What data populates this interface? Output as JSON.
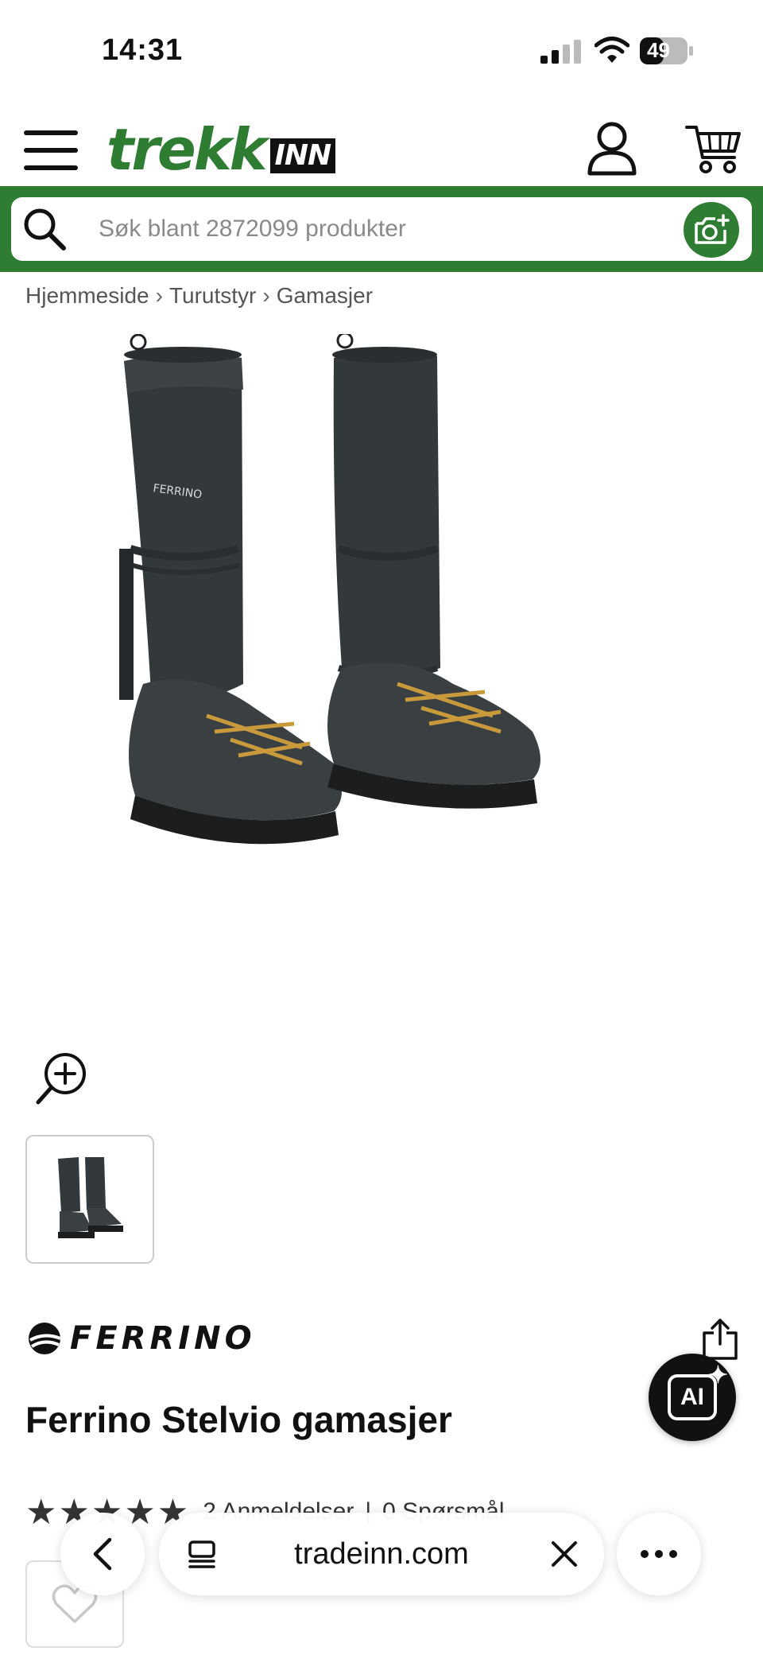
{
  "status_bar": {
    "time": "14:31",
    "battery": "49"
  },
  "header": {
    "logo_primary": "trekk",
    "logo_secondary": "INN"
  },
  "search": {
    "placeholder": "Søk blant 2872099 produkter"
  },
  "breadcrumb": [
    "Hjemmeside",
    "Turutstyr",
    "Gamasjer"
  ],
  "product": {
    "brand": "FERRINO",
    "name": "Ferrino Stelvio gamasjer",
    "image_brand_print": "FERRINO",
    "rating": {
      "stars": 5,
      "reviews": "2 Anmeldelser",
      "questions": "0 Spørsmål"
    }
  },
  "ai_button": {
    "label": "AI"
  },
  "browser": {
    "url": "tradeinn.com"
  },
  "colors": {
    "accent": "#2e7d32",
    "text": "#111111"
  },
  "icons": [
    "menu-icon",
    "user-icon",
    "cart-icon",
    "search-icon",
    "camera-icon",
    "zoom-in-icon",
    "share-icon",
    "ai-icon",
    "heart-icon",
    "back-icon",
    "tabs-icon",
    "close-icon",
    "more-icon"
  ]
}
